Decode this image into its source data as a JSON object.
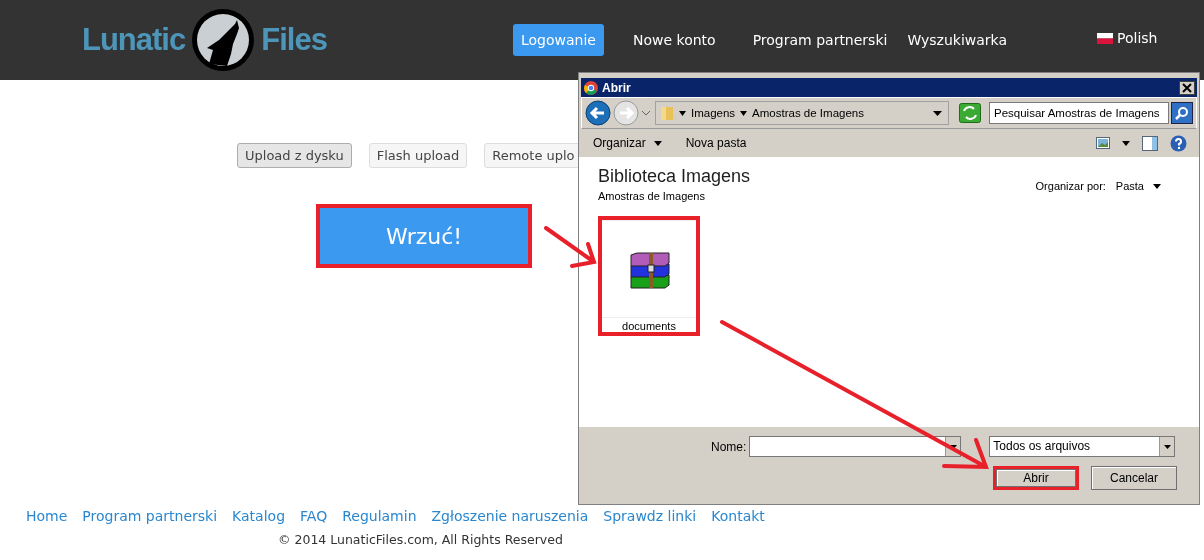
{
  "header": {
    "logo": {
      "left": "Lunatic",
      "right": "Files"
    },
    "nav": [
      {
        "label": "Logowanie",
        "selected": true
      },
      {
        "label": "Nowe konto",
        "selected": false
      },
      {
        "label": "Program partnerski",
        "selected": false
      },
      {
        "label": "Wyszukiwarka",
        "selected": false
      }
    ],
    "language": "Polish"
  },
  "upload_tabs": [
    {
      "label": "Upload z dysku",
      "selected": true
    },
    {
      "label": "Flash upload",
      "selected": false
    },
    {
      "label": "Remote uplo",
      "selected": false
    }
  ],
  "upload_button": {
    "label": "Wrzuć!",
    "highlighted": true
  },
  "dialog": {
    "title": "Abrir",
    "breadcrumb": [
      "Imagens",
      "Amostras de Imagens"
    ],
    "search": {
      "placeholder": "Pesquisar Amostras de Imagens"
    },
    "toolbar": [
      {
        "label": "Organizar",
        "kind": "menu"
      },
      {
        "label": "Nova pasta",
        "kind": "button"
      }
    ],
    "library_title": "Biblioteca Imagens",
    "library_subtitle": "Amostras de Imagens",
    "arrange_label": "Organizar por:",
    "arrange_value": "Pasta",
    "files": [
      {
        "name": "documents",
        "highlighted": true
      }
    ],
    "filename_label": "Nome:",
    "filter": "Todos os arquivos",
    "buttons": [
      {
        "label": "Abrir",
        "highlighted": true
      },
      {
        "label": "Cancelar",
        "highlighted": false
      }
    ]
  },
  "footer": {
    "links": [
      "Home",
      "Program partnerski",
      "Katalog",
      "FAQ",
      "Regulamin",
      "Zgłoszenie naruszenia",
      "Sprawdz linki",
      "Kontakt"
    ],
    "copyright": "© 2014 LunaticFiles.com, All Rights Reserved"
  }
}
